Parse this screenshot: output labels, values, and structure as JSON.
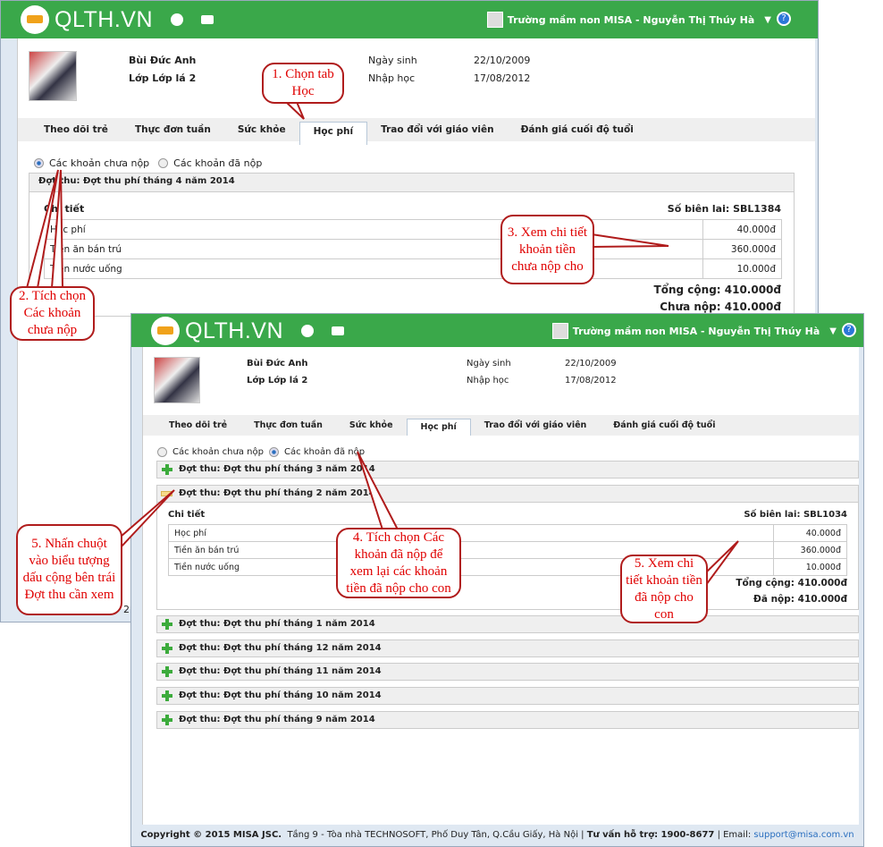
{
  "header": {
    "logo": "QLTH.VN",
    "school_user": "Trường mầm non MISA - Nguyễn Thị Thúy Hà",
    "help": "?"
  },
  "student": {
    "name": "Bùi Đức Anh",
    "class": "Lớp Lớp lá 2",
    "dob_label": "Ngày sinh",
    "dob": "22/10/2009",
    "enroll_label": "Nhập học",
    "enroll": "17/08/2012"
  },
  "tabs": [
    "Theo dõi trẻ",
    "Thực đơn tuần",
    "Sức khỏe",
    "Học phí",
    "Trao đổi với giáo viên",
    "Đánh giá cuối độ tuổi"
  ],
  "radios": {
    "unpaid": "Các khoản chưa nộp",
    "paid": "Các khoản đã nộp"
  },
  "window1": {
    "period": "Đợt thu: Đợt thu phí tháng 4 năm 2014",
    "detail": "Chi tiết",
    "receipt": "Số biên lai: SBL1384",
    "items": [
      {
        "name": "Học phí",
        "amount": "40.000đ"
      },
      {
        "name": "Tiền ăn bán trú",
        "amount": "360.000đ"
      },
      {
        "name": "Tiền nước uống",
        "amount": "10.000đ"
      }
    ],
    "total": "Tổng cộng: 410.000đ",
    "unpaid": "Chưa nộp: 410.000đ",
    "fragment": "2"
  },
  "window2": {
    "periods": [
      "Đợt thu: Đợt thu phí tháng 3 năm 2014",
      "Đợt thu: Đợt thu phí tháng 2 năm 2014",
      "Đợt thu: Đợt thu phí tháng 1 năm 2014",
      "Đợt thu: Đợt thu phí tháng 12 năm 2014",
      "Đợt thu: Đợt thu phí tháng 11 năm 2014",
      "Đợt thu: Đợt thu phí tháng 10 năm 2014",
      "Đợt thu: Đợt thu phí tháng 9 năm 2014"
    ],
    "detail": "Chi tiết",
    "receipt": "Số biên lai: SBL1034",
    "items": [
      {
        "name": "Học phí",
        "amount": "40.000đ"
      },
      {
        "name": "Tiền ăn bán trú",
        "amount": "360.000đ"
      },
      {
        "name": "Tiền nước uống",
        "amount": "10.000đ"
      }
    ],
    "total": "Tổng cộng: 410.000đ",
    "paid": "Đã nộp: 410.000đ"
  },
  "footer": {
    "copyright": "Copyright © 2015 MISA JSC.",
    "address": "Tầng 9 - Tòa nhà TECHNOSOFT, Phố Duy Tân, Q.Cầu Giấy, Hà Nội |",
    "support": "Tư vấn hỗ trợ: 1900-8677",
    "email_label": "| Email:",
    "email": "support@misa.com.vn"
  },
  "callouts": {
    "c1": "1. Chọn tab Học",
    "c2": "2. Tích chọn Các khoản chưa nộp",
    "c3": "3. Xem chi tiết khoản tiền chưa nộp cho",
    "c4": "4. Tích chọn Các khoản đã nộp để xem lại các khoản tiền đã nộp cho con",
    "c5a": "5. Nhấn chuột vào biểu tượng dấu cộng bên trái Đợt thu cần xem",
    "c5b": "5. Xem chi tiết khoản tiền đã nộp cho con"
  }
}
